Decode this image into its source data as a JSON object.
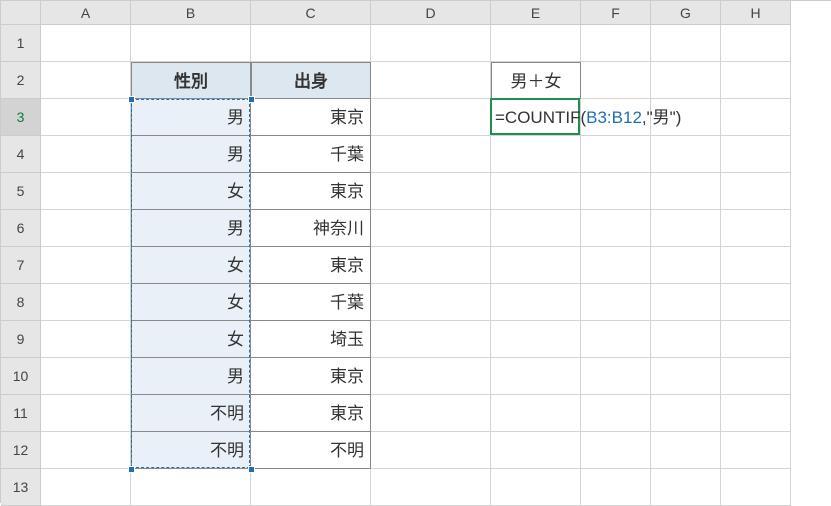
{
  "columns": [
    {
      "letter": "A",
      "cls": "col-A"
    },
    {
      "letter": "B",
      "cls": "col-B"
    },
    {
      "letter": "C",
      "cls": "col-C"
    },
    {
      "letter": "D",
      "cls": "col-D"
    },
    {
      "letter": "E",
      "cls": "col-E"
    },
    {
      "letter": "F",
      "cls": "col-F"
    },
    {
      "letter": "G",
      "cls": "col-G"
    },
    {
      "letter": "H",
      "cls": "col-H"
    }
  ],
  "row_count": 13,
  "active_row": 3,
  "table": {
    "headers": {
      "b": "性別",
      "c": "出身"
    },
    "rows": [
      {
        "b": "男",
        "c": "東京"
      },
      {
        "b": "男",
        "c": "千葉"
      },
      {
        "b": "女",
        "c": "東京"
      },
      {
        "b": "男",
        "c": "神奈川"
      },
      {
        "b": "女",
        "c": "東京"
      },
      {
        "b": "女",
        "c": "千葉"
      },
      {
        "b": "女",
        "c": "埼玉"
      },
      {
        "b": "男",
        "c": "東京"
      },
      {
        "b": "不明",
        "c": "東京"
      },
      {
        "b": "不明",
        "c": "不明"
      }
    ]
  },
  "summary": {
    "label": "男＋女"
  },
  "formula": {
    "prefix": "=COUNTIF(",
    "ref": "B3:B12",
    "suffix": ",\"男\")"
  },
  "selection": {
    "range": "B3:B12",
    "active_cell": "E3"
  }
}
